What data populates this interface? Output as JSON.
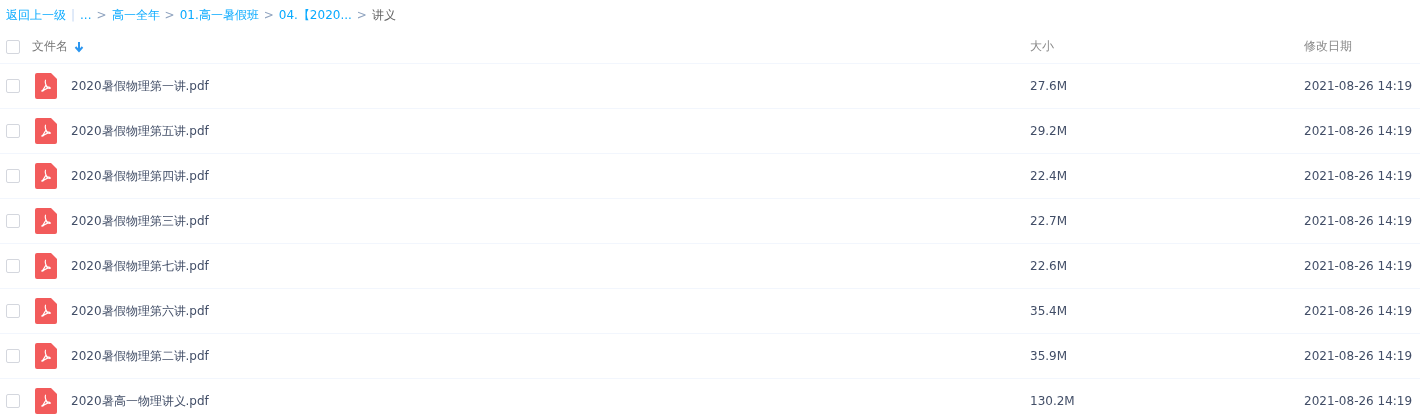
{
  "breadcrumb": [
    {
      "kind": "link",
      "label": "返回上一级"
    },
    {
      "kind": "divider",
      "label": "|"
    },
    {
      "kind": "link",
      "label": "..."
    },
    {
      "kind": "separator",
      "label": ">"
    },
    {
      "kind": "link",
      "label": "高一全年"
    },
    {
      "kind": "separator",
      "label": ">"
    },
    {
      "kind": "link",
      "label": "01.高一暑假班"
    },
    {
      "kind": "separator",
      "label": ">"
    },
    {
      "kind": "link",
      "label": "04.【2020..."
    },
    {
      "kind": "separator",
      "label": ">"
    },
    {
      "kind": "current",
      "label": "讲义"
    }
  ],
  "table": {
    "select_all": {
      "checked": false
    },
    "columns": [
      {
        "label": "文件名",
        "sorted": true
      },
      {
        "label": "大小",
        "sorted": false
      },
      {
        "label": "修改日期",
        "sorted": false
      }
    ],
    "rows": [
      {
        "checked": false,
        "name": "2020暑假物理第一讲.pdf",
        "size": "27.6M",
        "modified": "2021-08-26 14:19"
      },
      {
        "checked": false,
        "name": "2020暑假物理第五讲.pdf",
        "size": "29.2M",
        "modified": "2021-08-26 14:19"
      },
      {
        "checked": false,
        "name": "2020暑假物理第四讲.pdf",
        "size": "22.4M",
        "modified": "2021-08-26 14:19"
      },
      {
        "checked": false,
        "name": "2020暑假物理第三讲.pdf",
        "size": "22.7M",
        "modified": "2021-08-26 14:19"
      },
      {
        "checked": false,
        "name": "2020暑假物理第七讲.pdf",
        "size": "22.6M",
        "modified": "2021-08-26 14:19"
      },
      {
        "checked": false,
        "name": "2020暑假物理第六讲.pdf",
        "size": "35.4M",
        "modified": "2021-08-26 14:19"
      },
      {
        "checked": false,
        "name": "2020暑假物理第二讲.pdf",
        "size": "35.9M",
        "modified": "2021-08-26 14:19"
      },
      {
        "checked": false,
        "name": "2020暑高一物理讲义.pdf",
        "size": "130.2M",
        "modified": "2021-08-26 14:19"
      }
    ]
  }
}
